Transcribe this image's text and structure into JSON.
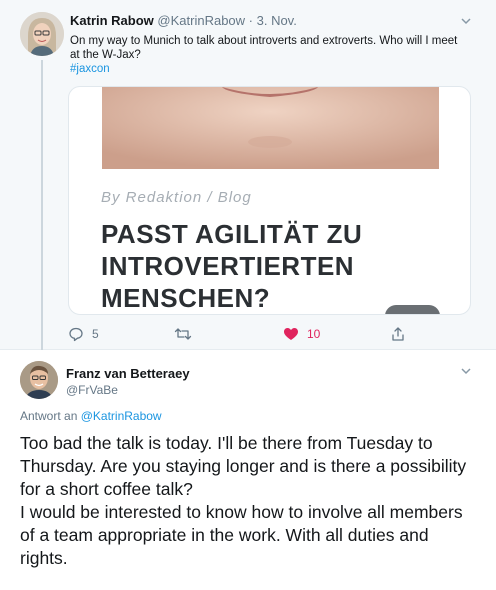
{
  "parent_tweet": {
    "author_name": "Katrin Rabow",
    "author_handle": "@KatrinRabow",
    "separator": " · ",
    "date": "3. Nov.",
    "text": "On my way to Munich to talk about introverts and extroverts. Who will I meet at the W-Jax?",
    "hashtag": "#jaxcon",
    "card": {
      "meta": "By Redaktion  /  Blog",
      "title": "PASST AGILITÄT ZU INTROVERTIERTEN MENSCHEN?"
    },
    "actions": {
      "reply_count": "5",
      "retweet_count": "",
      "like_count": "10"
    }
  },
  "reply_tweet": {
    "author_name": "Franz van Betteraey",
    "author_handle": "@FrVaBe",
    "reply_label": "Antwort an",
    "reply_to_handle": "@KatrinRabow",
    "text_paragraphs": [
      "Too bad the talk is today. I'll be there from Tuesday to Thursday. Are you staying longer and is there a possibility for a short coffee talk?",
      "I would be interested to know how to involve all members of a team appropriate in the work. With all duties and rights."
    ]
  },
  "colors": {
    "link": "#1b95e0",
    "like": "#e0245e",
    "muted": "#657786",
    "parent_background": "#f5f8fa"
  },
  "icons": [
    "chevron-down-icon",
    "reply-icon",
    "retweet-icon",
    "heart-icon",
    "share-icon"
  ]
}
